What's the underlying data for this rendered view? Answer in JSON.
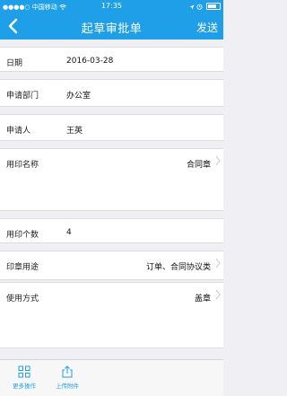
{
  "status_bar": {
    "carrier": "●●●●○ 中国移动",
    "time": "17:35",
    "battery_label": "100%"
  },
  "nav": {
    "title": "起草审批单",
    "send_label": "发送"
  },
  "form": {
    "date": {
      "label": "日期",
      "value": "2016-03-28"
    },
    "department": {
      "label": "申请部门",
      "value": "办公室"
    },
    "applicant": {
      "label": "申请人",
      "value": "王英"
    },
    "seal_name": {
      "label": "用印名称",
      "value": "合同章"
    },
    "seal_count": {
      "label": "用印个数",
      "value": "4"
    },
    "seal_purpose": {
      "label": "印章用途",
      "value": "订单、合同协议类"
    },
    "usage_method": {
      "label": "使用方式",
      "value": "盖章"
    }
  },
  "toolbar": {
    "more_actions_label": "更多操作",
    "upload_attachment_label": "上传附件"
  },
  "colors": {
    "accent": "#1e9fe8",
    "background": "#efeff4"
  },
  "icons": {
    "back": "chevron-left-icon",
    "more": "grid-icon",
    "upload": "upload-icon",
    "row_arrow": "chevron-right-icon"
  }
}
